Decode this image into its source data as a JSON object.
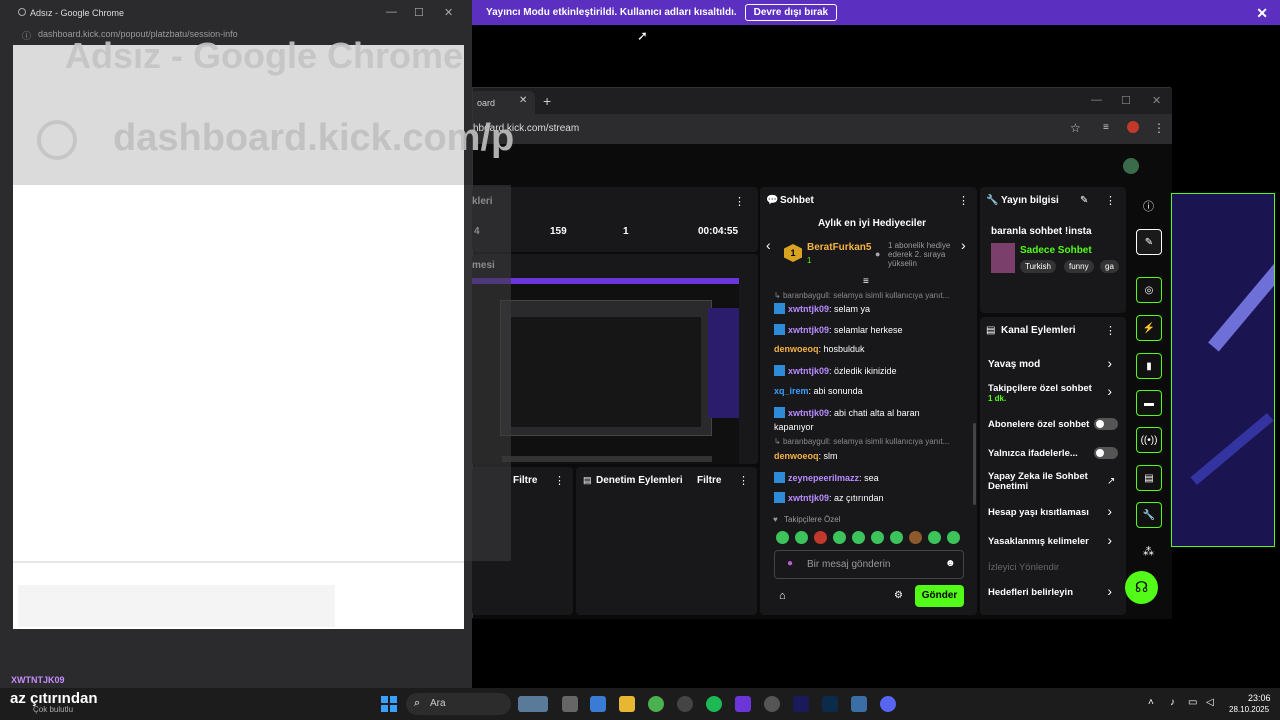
{
  "banner": {
    "message": "Yayıncı Modu etkinleştirildi. Kullanıcı adları kısaltıldı.",
    "action_label": "Devre dışı bırak",
    "close": "✕"
  },
  "main_window": {
    "tab_title": "oard",
    "tab_close": "✕",
    "new_tab": "+",
    "url": "hboard.kick.com/stream",
    "minimize": "—",
    "maximize": "☐",
    "close": "✕"
  },
  "stats_panel": {
    "title": "kleri",
    "values": [
      "4",
      "159",
      "1",
      "00:04:55"
    ]
  },
  "preview_panel": {
    "title": "mesi"
  },
  "filter_panel_left": {
    "filter_label": "Filtre"
  },
  "moderation_panel": {
    "title": "Denetim Eylemleri",
    "filter_label": "Filtre"
  },
  "chat": {
    "title": "Sohbet",
    "top_gifters_title": "Aylık en iyi Hediyeciler",
    "top_gifter": {
      "name": "BeratFurkan5",
      "rank": "1",
      "count": "1"
    },
    "gift_note": "1 abonelik hediye ederek 2. sıraya yükselin",
    "messages": [
      {
        "type": "system",
        "text": "baranbaygull: selamya isimli kullanıcıya yanıt..."
      },
      {
        "user": "xwtntjk09",
        "text": "selam ya",
        "color": "#b88cff",
        "badge": true
      },
      {
        "user": "xwtntjk09",
        "text": "selamlar herkese",
        "color": "#b88cff",
        "badge": true
      },
      {
        "user": "denwoeoq",
        "text": "hosbulduk",
        "color": "#f5b342",
        "badge": false
      },
      {
        "user": "xwtntjk09",
        "text": "özledik ikinizide",
        "color": "#b88cff",
        "badge": true
      },
      {
        "user": "xq_irem",
        "text": "abi sonunda",
        "color": "#3aa0ff",
        "badge": false
      },
      {
        "user": "xwtntjk09",
        "text": "abi chati alta al baran kapanıyor",
        "color": "#b88cff",
        "badge": true
      },
      {
        "type": "system",
        "text": "baranbaygull: selamya isimli kullanıcıya yanıt..."
      },
      {
        "user": "denwoeoq",
        "text": "slm",
        "color": "#f5b342",
        "badge": false
      },
      {
        "user": "zeynepeerilmazz",
        "text": "sea",
        "color": "#b88cff",
        "badge": true
      },
      {
        "user": "xwtntjk09",
        "text": "az çıtırından",
        "color": "#b88cff",
        "badge": true
      }
    ],
    "followers_only_label": "Takipçilere Özel",
    "input_placeholder": "Bir mesaj gönderin",
    "send_label": "Gönder"
  },
  "stream_info": {
    "title": "Yayın bilgisi",
    "stream_title": "baranla sohbet !insta",
    "category": "Sadece Sohbet",
    "tags": [
      "Turkish",
      "funny",
      "ga"
    ]
  },
  "channel_actions": {
    "title": "Kanal Eylemleri",
    "items": [
      {
        "label": "Yavaş mod",
        "kind": "chevron"
      },
      {
        "label": "Takipçilere özel sohbet",
        "sub": "1 dk.",
        "kind": "chevron"
      },
      {
        "label": "Abonelere özel sohbet",
        "kind": "toggle"
      },
      {
        "label": "Yalnızca ifadelerle...",
        "kind": "toggle"
      },
      {
        "label": "Yapay Zeka ile Sohbet Denetimi",
        "kind": "external"
      },
      {
        "label": "Hesap yaşı kısıtlaması",
        "kind": "chevron"
      },
      {
        "label": "Yasaklanmış kelimeler",
        "kind": "chevron"
      },
      {
        "label": "İzleyici Yönlendir",
        "kind": "disabled"
      },
      {
        "label": "Hedefleri belirleyin",
        "kind": "chevron"
      }
    ]
  },
  "popout": {
    "title": "Adsız - Google Chrome",
    "url": "dashboard.kick.com/popout/platzbatu/session-info",
    "overlay_title": "Adsız - Google Chrome",
    "overlay_url": "dashboard.kick.com/p",
    "minimize": "—",
    "maximize": "☐",
    "close": "✕"
  },
  "overlay_chat": {
    "user": "XWTNTJK09",
    "message": "az çıtırından",
    "sub": "Çok bulutlu"
  },
  "taskbar": {
    "search_label": "Ara",
    "time": "23:06",
    "date": "28.10.2025"
  }
}
